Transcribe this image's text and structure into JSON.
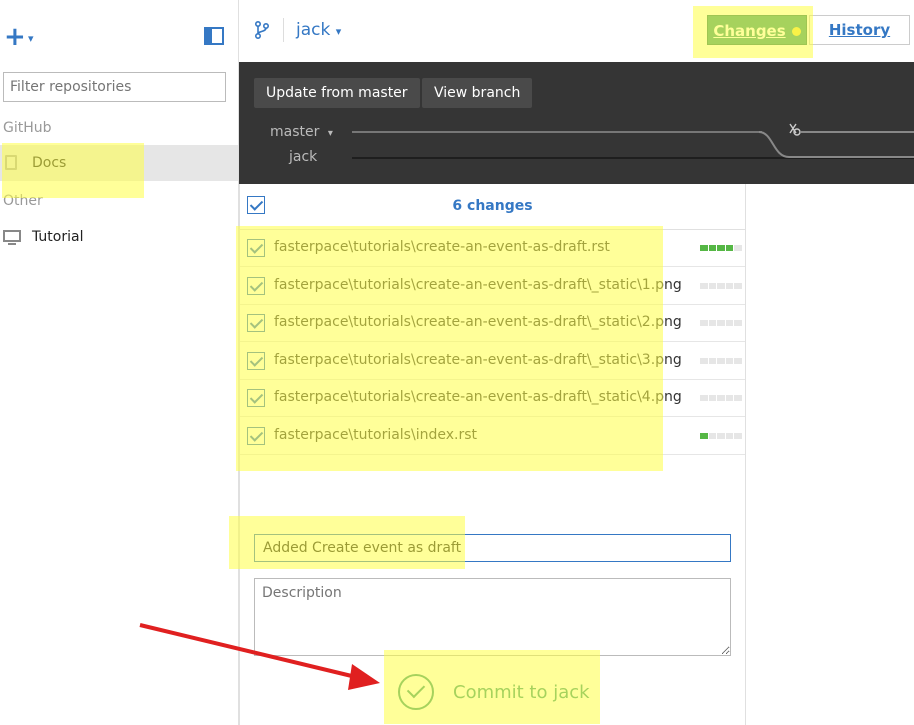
{
  "sidebar": {
    "add_caret": "▾",
    "filter_placeholder": "Filter repositories",
    "sections": [
      {
        "label": "GitHub",
        "repos": [
          {
            "name": "Docs",
            "icon": "repo-book-icon"
          }
        ]
      },
      {
        "label": "Other",
        "repos": [
          {
            "name": "Tutorial",
            "icon": "computer-icon"
          }
        ]
      }
    ]
  },
  "toolbar": {
    "branch_name": "jack",
    "branch_caret": "▾",
    "tab_changes": "Changes",
    "tab_history": "History"
  },
  "branch_bar": {
    "update_button": "Update from master",
    "view_branch_button": "View branch",
    "branches": [
      "master",
      "jack"
    ],
    "master_caret": "▾"
  },
  "changes": {
    "count_label": "6 changes",
    "files": [
      {
        "path": "fasterpace\\tutorials\\create-an-event-as-draft.rst",
        "added": 4
      },
      {
        "path": "fasterpace\\tutorials\\create-an-event-as-draft\\_static\\1.png",
        "added": 0
      },
      {
        "path": "fasterpace\\tutorials\\create-an-event-as-draft\\_static\\2.png",
        "added": 0
      },
      {
        "path": "fasterpace\\tutorials\\create-an-event-as-draft\\_static\\3.png",
        "added": 0
      },
      {
        "path": "fasterpace\\tutorials\\create-an-event-as-draft\\_static\\4.png",
        "added": 0
      },
      {
        "path": "fasterpace\\tutorials\\index.rst",
        "added": 1
      }
    ]
  },
  "commit": {
    "summary_value": "Added Create event as draft",
    "description_placeholder": "Description",
    "button_label": "Commit to jack"
  },
  "colors": {
    "accent_blue": "#3578c4",
    "accent_green": "#3a9b7a",
    "highlight": "#ffff46",
    "arrow_red": "#e02020"
  }
}
